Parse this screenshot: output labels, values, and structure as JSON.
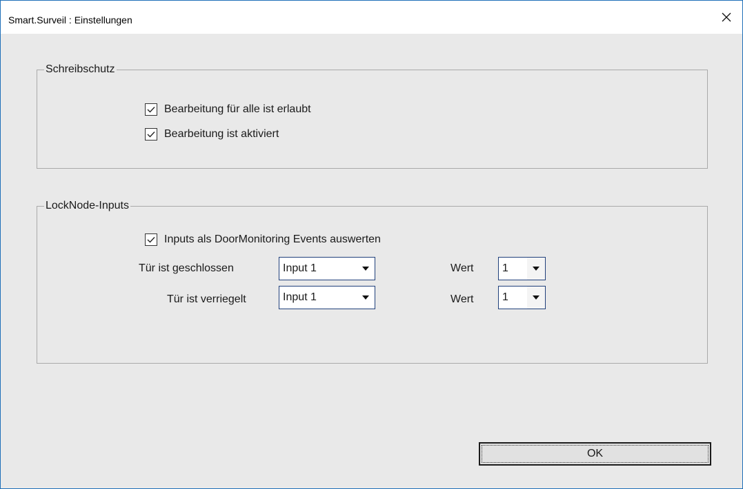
{
  "window": {
    "title": "Smart.Surveil : Einstellungen",
    "close_icon": "close-icon"
  },
  "schreibschutz": {
    "legend": "Schreibschutz",
    "checkboxes": [
      {
        "label": "Bearbeitung für alle ist erlaubt",
        "checked": true
      },
      {
        "label": "Bearbeitung ist aktiviert",
        "checked": true
      }
    ]
  },
  "locknode": {
    "legend": "LockNode-Inputs",
    "checkbox": {
      "label": "Inputs als DoorMonitoring Events auswerten",
      "checked": true
    },
    "rows": [
      {
        "label": "Tür ist geschlossen",
        "input_value": "Input 1",
        "wert_label": "Wert",
        "wert_value": "1"
      },
      {
        "label": "Tür ist verriegelt",
        "input_value": "Input 1",
        "wert_label": "Wert",
        "wert_value": "1"
      }
    ]
  },
  "buttons": {
    "ok_label": "OK"
  }
}
